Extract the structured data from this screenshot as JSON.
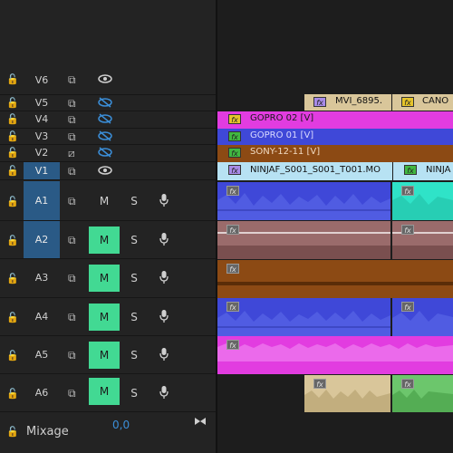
{
  "tracks": {
    "video": [
      {
        "id": "v6",
        "label": "V6",
        "eye_hidden": false
      },
      {
        "id": "v5",
        "label": "V5",
        "eye_hidden": true
      },
      {
        "id": "v4",
        "label": "V4",
        "eye_hidden": true
      },
      {
        "id": "v3",
        "label": "V3",
        "eye_hidden": true
      },
      {
        "id": "v2",
        "label": "V2",
        "eye_hidden": true
      },
      {
        "id": "v1",
        "label": "V1",
        "eye_hidden": false
      }
    ],
    "audio": [
      {
        "id": "a1",
        "label": "A1",
        "mute_on": false,
        "solo": "S"
      },
      {
        "id": "a2",
        "label": "A2",
        "mute_on": true,
        "solo": "S"
      },
      {
        "id": "a3",
        "label": "A3",
        "mute_on": true,
        "solo": "S"
      },
      {
        "id": "a4",
        "label": "A4",
        "mute_on": true,
        "solo": "S"
      },
      {
        "id": "a5",
        "label": "A5",
        "mute_on": true,
        "solo": "S"
      },
      {
        "id": "a6",
        "label": "A6",
        "mute_on": true,
        "solo": "S"
      }
    ],
    "mute_label": "M"
  },
  "clips": {
    "v5_a": "MVI_6895.",
    "v5_b": "CANO",
    "v4": "GOPRO 02 [V]",
    "v3": "GOPRO 01 [V]",
    "v2": "SONY-12-11 [V]",
    "v1_a": "NINJAF_S001_S001_T001.MO",
    "v1_b": "NINJA"
  },
  "fx_label": "fx",
  "mixage": {
    "label": "Mixage",
    "value": "0,0"
  },
  "colors": {
    "accent": "#42d993",
    "selected_track": "#2a5a86",
    "eye_blue": "#3b8ed8",
    "clip_tan": "#d9c69a",
    "clip_magenta": "#e23ce0",
    "clip_blue": "#3f48d8",
    "clip_brown": "#8c4a14",
    "clip_lightblue": "#b7e2f3",
    "clip_teal": "#2fe3c8",
    "clip_green": "#6cc66c",
    "clip_gray": "#9a6b6b"
  }
}
